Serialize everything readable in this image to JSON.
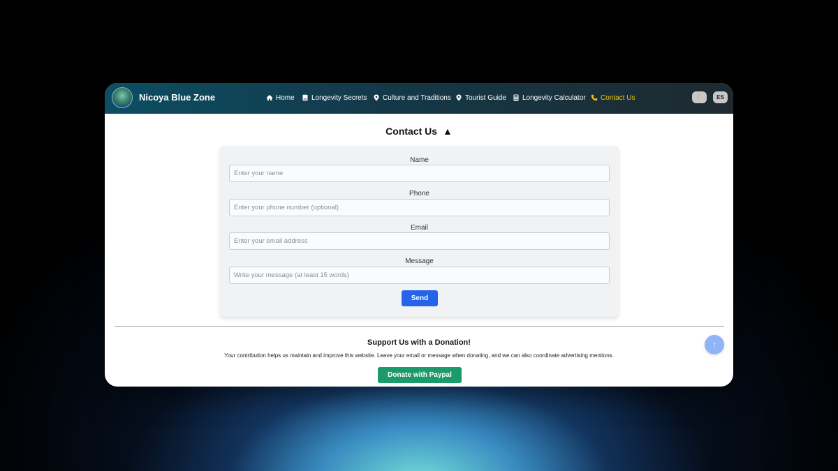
{
  "brand": {
    "name": "Nicoya Blue Zone"
  },
  "nav": {
    "items": [
      {
        "label": "Home",
        "icon": "home-icon",
        "active": false
      },
      {
        "label": "Longevity Secrets",
        "icon": "book-icon",
        "active": false
      },
      {
        "label": "Culture and Traditions",
        "icon": "map-pin-icon",
        "active": false
      },
      {
        "label": "Tourist Guide",
        "icon": "map-pin-icon",
        "active": false
      },
      {
        "label": "Longevity Calculator",
        "icon": "calculator-icon",
        "active": false
      },
      {
        "label": "Contact Us",
        "icon": "phone-icon",
        "active": true
      }
    ],
    "mode_toggle_icon": "moon-icon",
    "language_label": "ES"
  },
  "contact": {
    "title": "Contact Us",
    "title_icon": "triangle-up-icon",
    "fields": [
      {
        "label": "Name",
        "placeholder": "Enter your name",
        "value": ""
      },
      {
        "label": "Phone",
        "placeholder": "Enter your phone number (optional)",
        "value": ""
      },
      {
        "label": "Email",
        "placeholder": "Enter your email address",
        "value": ""
      },
      {
        "label": "Message",
        "placeholder": "Write your message (at least 15 words)",
        "value": ""
      }
    ],
    "send_label": "Send"
  },
  "donation": {
    "title": "Support Us with a Donation!",
    "text": "Your contribution helps us maintain and improve this website. Leave your email or message when donating, and we can also coordinate advertising mentions.",
    "button_label": "Donate with Paypal"
  },
  "colors": {
    "nav_gradient_start": "#0c4e63",
    "nav_gradient_end": "#1e2a30",
    "active_nav": "#f1c40f",
    "send_button": "#2563eb",
    "paypal_button": "#1d9a6c",
    "scroll_top": "#8fb4f7"
  }
}
